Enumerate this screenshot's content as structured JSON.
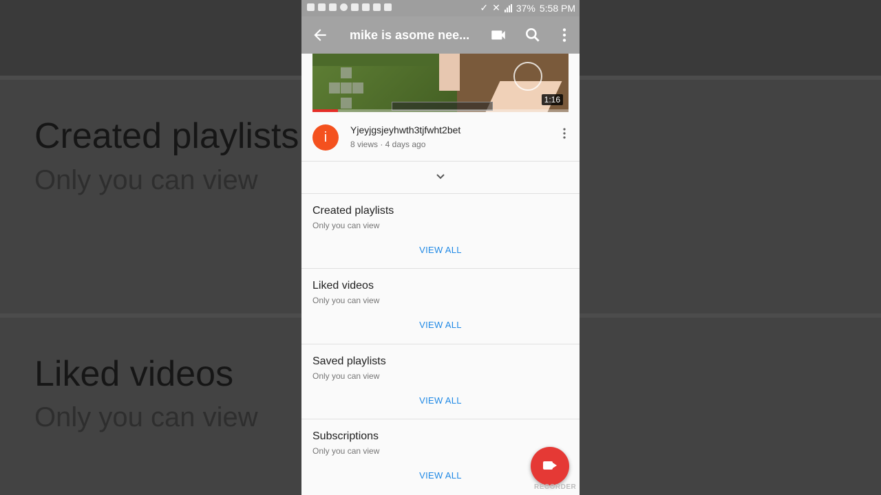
{
  "background": {
    "items": [
      {
        "title": "Created playlists",
        "sub": "Only you can view"
      },
      {
        "title": "Liked videos",
        "sub": "Only you can view"
      }
    ]
  },
  "status": {
    "battery": "37%",
    "time": "5:58 PM"
  },
  "appbar": {
    "title": "mike is asome nee..."
  },
  "video": {
    "duration": "1:16",
    "progress_fraction": 0.1,
    "avatar_letter": "i",
    "title": "Yjeyjgsjeyhwth3tjfwht2bet",
    "meta": "8 views · 4 days ago"
  },
  "sections": [
    {
      "title": "Created playlists",
      "subtitle": "Only you can view",
      "action": "VIEW ALL"
    },
    {
      "title": "Liked videos",
      "subtitle": "Only you can view",
      "action": "VIEW ALL"
    },
    {
      "title": "Saved playlists",
      "subtitle": "Only you can view",
      "action": "VIEW ALL"
    },
    {
      "title": "Subscriptions",
      "subtitle": "Only you can view",
      "action": "VIEW ALL"
    }
  ],
  "fab": {
    "label": "RECORDER"
  },
  "colors": {
    "accent": "#1e88e5",
    "fab": "#e53935",
    "avatar": "#f4511e",
    "progress": "#e52d27"
  }
}
